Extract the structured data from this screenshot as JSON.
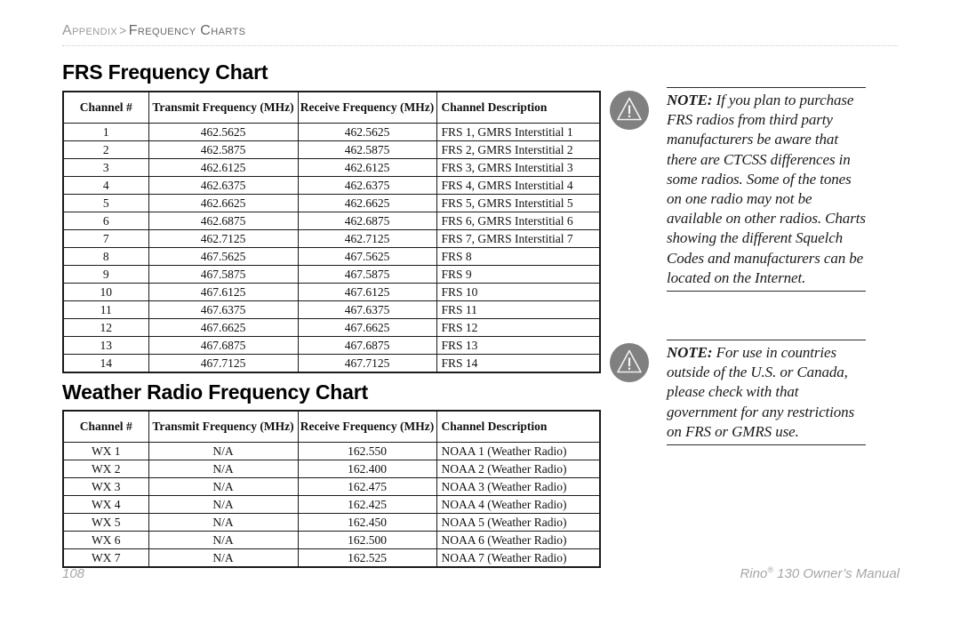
{
  "breadcrumb": {
    "appendix": "Appendix",
    "separator": ">",
    "section": "Frequency Charts"
  },
  "frs_chart": {
    "title": "FRS Frequency Chart",
    "columns": [
      "Channel #",
      "Transmit Frequency (MHz)",
      "Receive Frequency (MHz)",
      "Channel Description"
    ],
    "rows": [
      [
        "1",
        "462.5625",
        "462.5625",
        "FRS 1, GMRS Interstitial 1"
      ],
      [
        "2",
        "462.5875",
        "462.5875",
        "FRS 2, GMRS Interstitial 2"
      ],
      [
        "3",
        "462.6125",
        "462.6125",
        "FRS 3, GMRS Interstitial 3"
      ],
      [
        "4",
        "462.6375",
        "462.6375",
        "FRS 4, GMRS Interstitial 4"
      ],
      [
        "5",
        "462.6625",
        "462.6625",
        "FRS 5, GMRS Interstitial 5"
      ],
      [
        "6",
        "462.6875",
        "462.6875",
        "FRS 6, GMRS Interstitial 6"
      ],
      [
        "7",
        "462.7125",
        "462.7125",
        "FRS 7, GMRS Interstitial 7"
      ],
      [
        "8",
        "467.5625",
        "467.5625",
        "FRS 8"
      ],
      [
        "9",
        "467.5875",
        "467.5875",
        "FRS 9"
      ],
      [
        "10",
        "467.6125",
        "467.6125",
        "FRS 10"
      ],
      [
        "11",
        "467.6375",
        "467.6375",
        "FRS 11"
      ],
      [
        "12",
        "467.6625",
        "467.6625",
        "FRS 12"
      ],
      [
        "13",
        "467.6875",
        "467.6875",
        "FRS 13"
      ],
      [
        "14",
        "467.7125",
        "467.7125",
        "FRS 14"
      ]
    ]
  },
  "weather_chart": {
    "title": "Weather Radio Frequency Chart",
    "columns": [
      "Channel #",
      "Transmit Frequency (MHz)",
      "Receive Frequency (MHz)",
      "Channel Description"
    ],
    "rows": [
      [
        "WX 1",
        "N/A",
        "162.550",
        "NOAA 1 (Weather Radio)"
      ],
      [
        "WX 2",
        "N/A",
        "162.400",
        "NOAA 2 (Weather Radio)"
      ],
      [
        "WX 3",
        "N/A",
        "162.475",
        "NOAA 3 (Weather Radio)"
      ],
      [
        "WX 4",
        "N/A",
        "162.425",
        "NOAA 4 (Weather Radio)"
      ],
      [
        "WX 5",
        "N/A",
        "162.450",
        "NOAA 5 (Weather Radio)"
      ],
      [
        "WX 6",
        "N/A",
        "162.500",
        "NOAA 6 (Weather Radio)"
      ],
      [
        "WX 7",
        "N/A",
        "162.525",
        "NOAA 7 (Weather Radio)"
      ]
    ]
  },
  "notes": [
    {
      "icon": "warning-triangle-icon",
      "label": "NOTE:",
      "text": " If you plan to purchase FRS radios from third party manufacturers be aware that there are CTCSS differences in some radios. Some of the tones on one radio may not be available on other radios. Charts showing the different Squelch Codes and manufacturers can be located on the Internet."
    },
    {
      "icon": "warning-triangle-icon",
      "label": "NOTE:",
      "text": " For use in countries outside of the U.S. or Canada, please check with that government for any restrictions on FRS or GMRS use."
    }
  ],
  "footer": {
    "page_number": "108",
    "manual_name_pre": "Rino",
    "manual_trademark": "®",
    "manual_name_post": " 130 Owner’s Manual"
  },
  "colors": {
    "note_icon_bg": "#808080",
    "breadcrumb_light": "#9a9a9a",
    "breadcrumb_dark": "#666666",
    "rule_dotted": "#c9c9cf",
    "footer_text": "#a6a6a6",
    "table_border": "#1a1a1a"
  }
}
